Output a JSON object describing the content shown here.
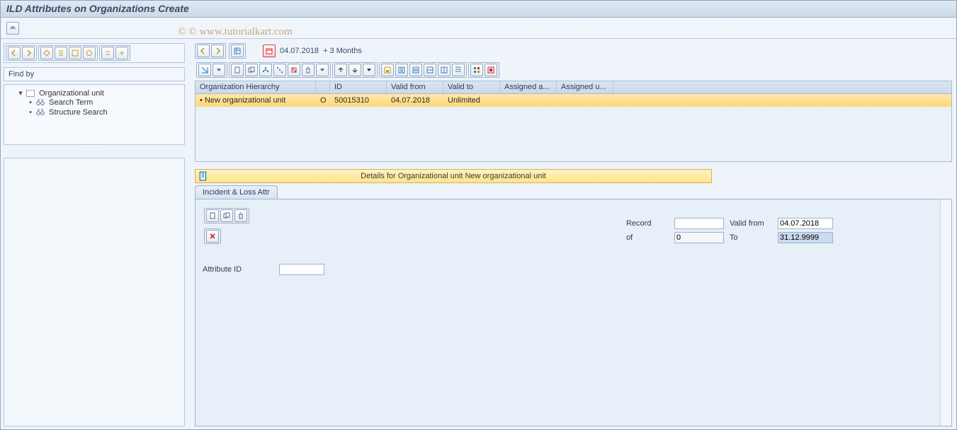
{
  "header": {
    "title": "ILD Attributes on Organizations Create"
  },
  "watermark": "© www.tutorialkart.com",
  "left": {
    "find_by": "Find by",
    "tree": {
      "root": "Organizational unit",
      "children": [
        "Search Term",
        "Structure Search"
      ]
    }
  },
  "right": {
    "date_hint_date": "04.07.2018",
    "date_hint_plus": "+ 3 Months",
    "columns": {
      "hier": "Organization Hierarchy",
      "id": "ID",
      "vf": "Valid from",
      "vt": "Valid to",
      "aa": "Assigned a...",
      "au": "Assigned u..."
    },
    "row": {
      "name": "New organizational unit",
      "code": "O",
      "id": "50015310",
      "vf": "04.07.2018",
      "vt": "Unlimited",
      "aa": "",
      "au": ""
    },
    "details_title": "Details for Organizational unit New organizational unit",
    "tab": "Incident & Loss Attr",
    "form": {
      "record_label": "Record",
      "of_label": "of",
      "valid_from_label": "Valid from",
      "to_label": "To",
      "attr_label": "Attribute ID",
      "record_value": "",
      "of_value": "0",
      "valid_from_value": "04.07.2018",
      "to_value": "31.12.9999",
      "attr_value": ""
    }
  }
}
